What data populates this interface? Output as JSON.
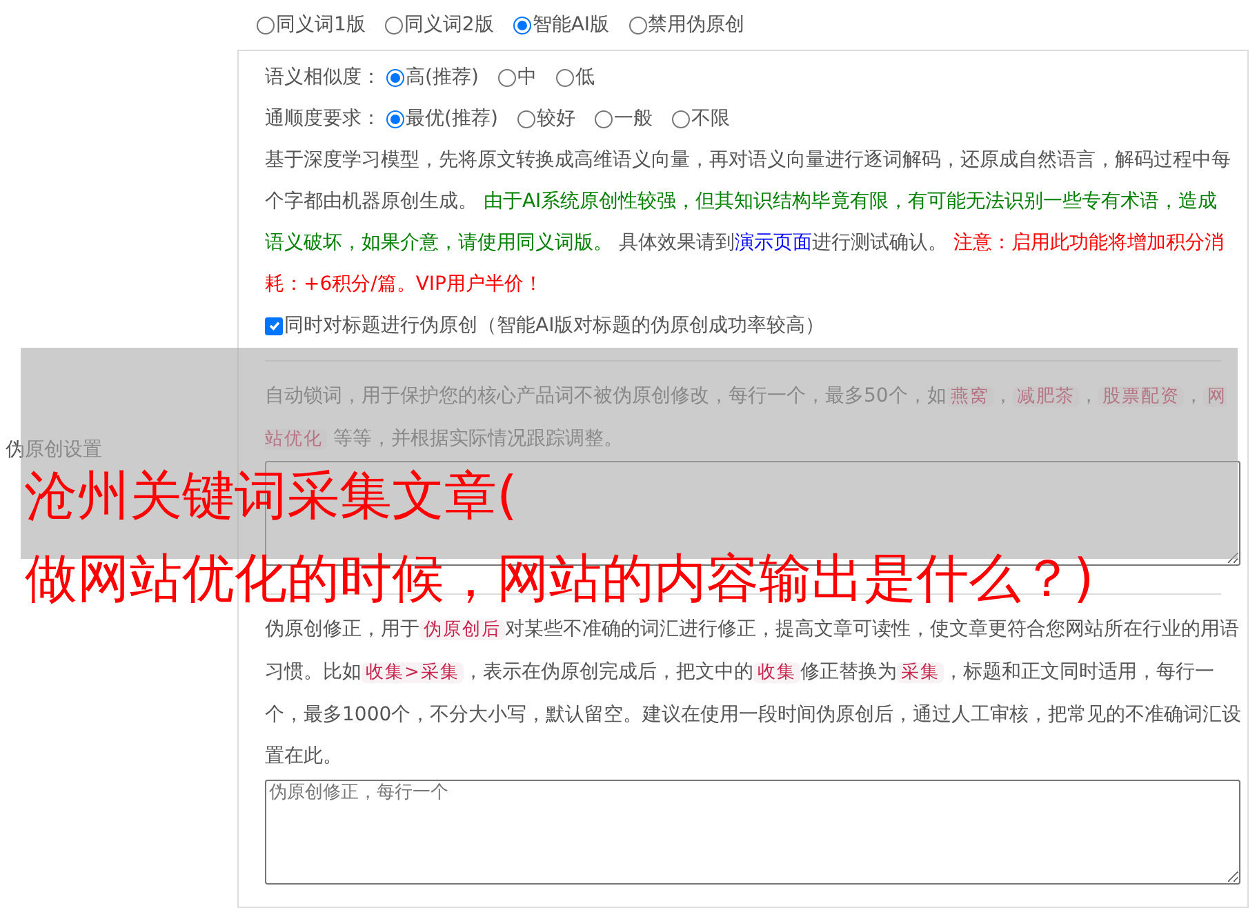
{
  "sidebar_label": "伪原创设置",
  "mode_options": [
    {
      "label": "同义词1版",
      "selected": false
    },
    {
      "label": "同义词2版",
      "selected": false
    },
    {
      "label": "智能AI版",
      "selected": true
    },
    {
      "label": "禁用伪原创",
      "selected": false
    }
  ],
  "similarity": {
    "label": "语义相似度：",
    "options": [
      {
        "label": "高(推荐)",
        "selected": true
      },
      {
        "label": "中",
        "selected": false
      },
      {
        "label": "低",
        "selected": false
      }
    ]
  },
  "fluency": {
    "label": "通顺度要求：",
    "options": [
      {
        "label": "最优(推荐)",
        "selected": true
      },
      {
        "label": "较好",
        "selected": false
      },
      {
        "label": "一般",
        "selected": false
      },
      {
        "label": "不限",
        "selected": false
      }
    ]
  },
  "ai_description": [
    {
      "kind": "plain",
      "text": "基于深度学习模型，先将原文转换成高维语义向量，再对语义向量进行逐词解码，还原成自然语言，解码过程中每个字都由机器原创生成。 "
    },
    {
      "kind": "note",
      "text": "由于AI系统原创性较强，但其知识结构毕竟有限，有可能无法识别一些专有术语，造成语义破坏，如果介意，请使用同义词版。"
    },
    {
      "kind": "plain",
      "text": " 具体效果请到"
    },
    {
      "kind": "link",
      "text": "演示页面"
    },
    {
      "kind": "plain",
      "text": "进行测试确认。 "
    },
    {
      "kind": "warning",
      "text": "注意：启用此功能将增加积分消耗：+6积分/篇。VIP用户半价！"
    }
  ],
  "title_option": {
    "label": "同时对标题进行伪原创（智能AI版对标题的伪原创成功率较高）",
    "checked": true
  },
  "lock_words": {
    "description": [
      {
        "kind": "plain",
        "text": "自动锁词，用于保护您的核心产品词不被伪原创修改，每行一个，最多50个，如"
      },
      {
        "kind": "tag",
        "text": "燕窝"
      },
      {
        "kind": "plain",
        "text": "，"
      },
      {
        "kind": "tag",
        "text": "减肥茶"
      },
      {
        "kind": "plain",
        "text": "，"
      },
      {
        "kind": "tag",
        "text": "股票配资"
      },
      {
        "kind": "plain",
        "text": "，"
      },
      {
        "kind": "tag",
        "text": "网站优化"
      },
      {
        "kind": "plain",
        "text": " 等等，并根据实际情况跟踪调整。"
      }
    ]
  },
  "corrections": {
    "description": [
      {
        "kind": "plain",
        "text": "伪原创修正，用于"
      },
      {
        "kind": "tag",
        "text": "伪原创后"
      },
      {
        "kind": "plain",
        "text": "对某些不准确的词汇进行修正，提高文章可读性，使文章更符合您网站所在行业的用语习惯。比如"
      },
      {
        "kind": "tag",
        "text": "收集>采集"
      },
      {
        "kind": "plain",
        "text": "，表示在伪原创完成后，把文中的"
      },
      {
        "kind": "tag",
        "text": "收集"
      },
      {
        "kind": "plain",
        "text": "修正替换为"
      },
      {
        "kind": "tag",
        "text": "采集"
      },
      {
        "kind": "plain",
        "text": "，标题和正文同时适用，每行一个，最多1000个，不分大小写，默认留空。建议在使用一段时间伪原创后，通过人工审核，把常见的不准确词汇设置在此。"
      }
    ],
    "placeholder": "伪原创修正，每行一个"
  },
  "overlay_title": [
    "沧州关键词采集文章(",
    "做网站优化的时候，网站的内容输出是什么？)"
  ]
}
